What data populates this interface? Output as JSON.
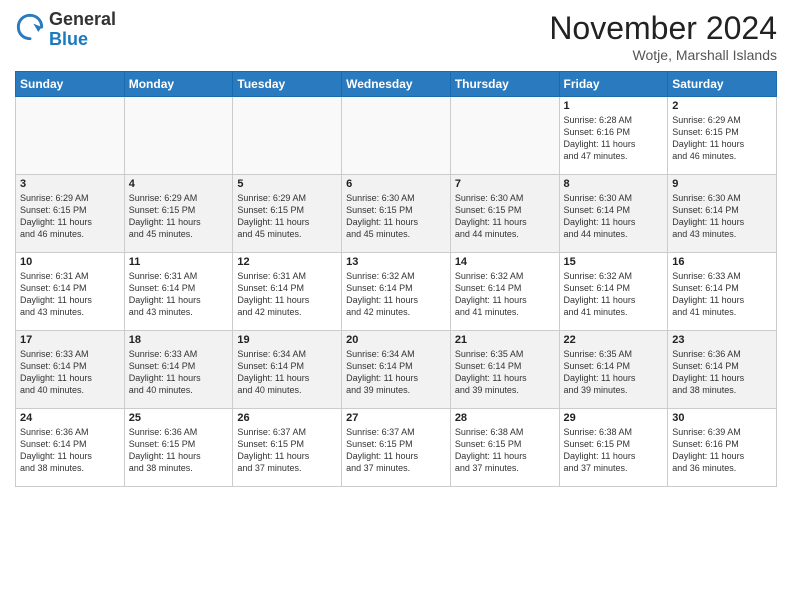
{
  "header": {
    "logo_general": "General",
    "logo_blue": "Blue",
    "month": "November 2024",
    "location": "Wotje, Marshall Islands"
  },
  "weekdays": [
    "Sunday",
    "Monday",
    "Tuesday",
    "Wednesday",
    "Thursday",
    "Friday",
    "Saturday"
  ],
  "weeks": [
    [
      {
        "day": "",
        "info": ""
      },
      {
        "day": "",
        "info": ""
      },
      {
        "day": "",
        "info": ""
      },
      {
        "day": "",
        "info": ""
      },
      {
        "day": "",
        "info": ""
      },
      {
        "day": "1",
        "info": "Sunrise: 6:28 AM\nSunset: 6:16 PM\nDaylight: 11 hours\nand 47 minutes."
      },
      {
        "day": "2",
        "info": "Sunrise: 6:29 AM\nSunset: 6:15 PM\nDaylight: 11 hours\nand 46 minutes."
      }
    ],
    [
      {
        "day": "3",
        "info": "Sunrise: 6:29 AM\nSunset: 6:15 PM\nDaylight: 11 hours\nand 46 minutes."
      },
      {
        "day": "4",
        "info": "Sunrise: 6:29 AM\nSunset: 6:15 PM\nDaylight: 11 hours\nand 45 minutes."
      },
      {
        "day": "5",
        "info": "Sunrise: 6:29 AM\nSunset: 6:15 PM\nDaylight: 11 hours\nand 45 minutes."
      },
      {
        "day": "6",
        "info": "Sunrise: 6:30 AM\nSunset: 6:15 PM\nDaylight: 11 hours\nand 45 minutes."
      },
      {
        "day": "7",
        "info": "Sunrise: 6:30 AM\nSunset: 6:15 PM\nDaylight: 11 hours\nand 44 minutes."
      },
      {
        "day": "8",
        "info": "Sunrise: 6:30 AM\nSunset: 6:14 PM\nDaylight: 11 hours\nand 44 minutes."
      },
      {
        "day": "9",
        "info": "Sunrise: 6:30 AM\nSunset: 6:14 PM\nDaylight: 11 hours\nand 43 minutes."
      }
    ],
    [
      {
        "day": "10",
        "info": "Sunrise: 6:31 AM\nSunset: 6:14 PM\nDaylight: 11 hours\nand 43 minutes."
      },
      {
        "day": "11",
        "info": "Sunrise: 6:31 AM\nSunset: 6:14 PM\nDaylight: 11 hours\nand 43 minutes."
      },
      {
        "day": "12",
        "info": "Sunrise: 6:31 AM\nSunset: 6:14 PM\nDaylight: 11 hours\nand 42 minutes."
      },
      {
        "day": "13",
        "info": "Sunrise: 6:32 AM\nSunset: 6:14 PM\nDaylight: 11 hours\nand 42 minutes."
      },
      {
        "day": "14",
        "info": "Sunrise: 6:32 AM\nSunset: 6:14 PM\nDaylight: 11 hours\nand 41 minutes."
      },
      {
        "day": "15",
        "info": "Sunrise: 6:32 AM\nSunset: 6:14 PM\nDaylight: 11 hours\nand 41 minutes."
      },
      {
        "day": "16",
        "info": "Sunrise: 6:33 AM\nSunset: 6:14 PM\nDaylight: 11 hours\nand 41 minutes."
      }
    ],
    [
      {
        "day": "17",
        "info": "Sunrise: 6:33 AM\nSunset: 6:14 PM\nDaylight: 11 hours\nand 40 minutes."
      },
      {
        "day": "18",
        "info": "Sunrise: 6:33 AM\nSunset: 6:14 PM\nDaylight: 11 hours\nand 40 minutes."
      },
      {
        "day": "19",
        "info": "Sunrise: 6:34 AM\nSunset: 6:14 PM\nDaylight: 11 hours\nand 40 minutes."
      },
      {
        "day": "20",
        "info": "Sunrise: 6:34 AM\nSunset: 6:14 PM\nDaylight: 11 hours\nand 39 minutes."
      },
      {
        "day": "21",
        "info": "Sunrise: 6:35 AM\nSunset: 6:14 PM\nDaylight: 11 hours\nand 39 minutes."
      },
      {
        "day": "22",
        "info": "Sunrise: 6:35 AM\nSunset: 6:14 PM\nDaylight: 11 hours\nand 39 minutes."
      },
      {
        "day": "23",
        "info": "Sunrise: 6:36 AM\nSunset: 6:14 PM\nDaylight: 11 hours\nand 38 minutes."
      }
    ],
    [
      {
        "day": "24",
        "info": "Sunrise: 6:36 AM\nSunset: 6:14 PM\nDaylight: 11 hours\nand 38 minutes."
      },
      {
        "day": "25",
        "info": "Sunrise: 6:36 AM\nSunset: 6:15 PM\nDaylight: 11 hours\nand 38 minutes."
      },
      {
        "day": "26",
        "info": "Sunrise: 6:37 AM\nSunset: 6:15 PM\nDaylight: 11 hours\nand 37 minutes."
      },
      {
        "day": "27",
        "info": "Sunrise: 6:37 AM\nSunset: 6:15 PM\nDaylight: 11 hours\nand 37 minutes."
      },
      {
        "day": "28",
        "info": "Sunrise: 6:38 AM\nSunset: 6:15 PM\nDaylight: 11 hours\nand 37 minutes."
      },
      {
        "day": "29",
        "info": "Sunrise: 6:38 AM\nSunset: 6:15 PM\nDaylight: 11 hours\nand 37 minutes."
      },
      {
        "day": "30",
        "info": "Sunrise: 6:39 AM\nSunset: 6:16 PM\nDaylight: 11 hours\nand 36 minutes."
      }
    ]
  ]
}
